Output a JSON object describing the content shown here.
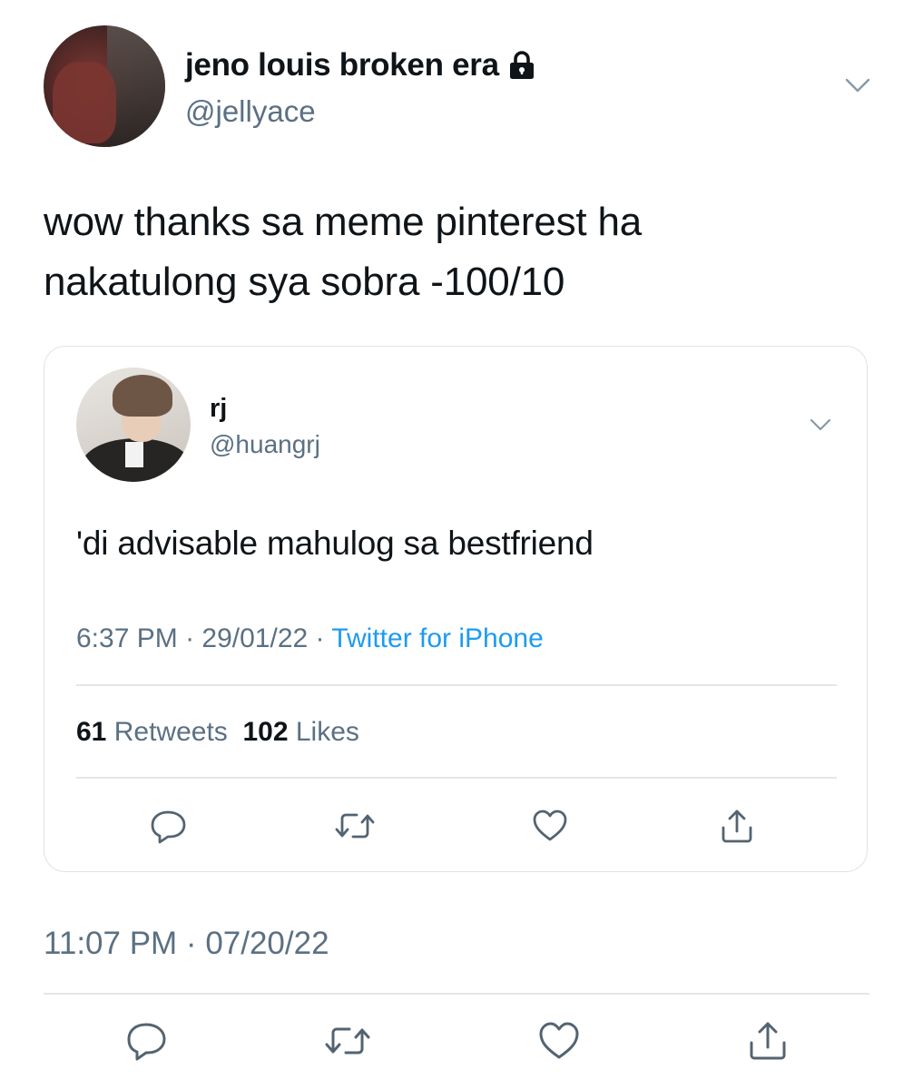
{
  "tweet": {
    "display_name": "jeno louis broken era",
    "handle": "@jellyace",
    "text_lines": [
      "wow thanks sa meme pinterest ha",
      "nakatulong sya sobra -100/10"
    ],
    "timestamp": "11:07 PM · 07/20/22",
    "icons": {
      "protected": "lock-icon",
      "menu": "chevron-down-icon",
      "reply": "reply-icon",
      "retweet": "retweet-icon",
      "like": "heart-icon",
      "share": "share-icon"
    }
  },
  "quoted_tweet": {
    "display_name": "rj",
    "handle": "@huangrj",
    "text": "'di advisable mahulog sa bestfriend",
    "time": "6:37 PM",
    "date": "29/01/22",
    "separator": "·",
    "source": "Twitter for iPhone",
    "retweets_count": "61",
    "retweets_label": "Retweets",
    "likes_count": "102",
    "likes_label": "Likes"
  },
  "colors": {
    "text": "#0f1419",
    "secondary": "#5b7083",
    "link": "#1d9bf0",
    "divider": "#e3e6e8",
    "card_border": "#dfe3e6"
  }
}
